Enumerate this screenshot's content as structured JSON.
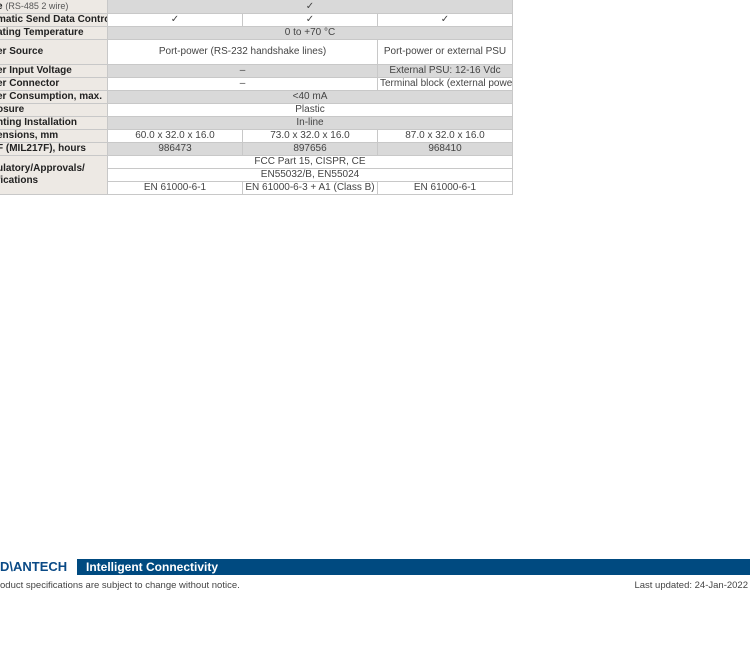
{
  "rows": [
    {
      "label": "e",
      "sub": "(RS-485 2 wire)",
      "span": "✓"
    },
    {
      "label": "matic Send Data Control",
      "cols": [
        "✓",
        "✓",
        "✓"
      ]
    },
    {
      "label": "ating Temperature",
      "span": "0 to +70 °C"
    },
    {
      "label": "er Source",
      "c12": "Port-power (RS-232 handshake lines)",
      "c3": "Port-power or external PSU"
    },
    {
      "label": "er Input Voltage",
      "c12": "–",
      "c3": "External PSU: 12-16 Vdc"
    },
    {
      "label": "er Connector",
      "c12": "–",
      "c3": "Terminal block (external power)"
    },
    {
      "label": "er Consumption, max.",
      "span": "<40 mA"
    },
    {
      "label": "osure",
      "span": "Plastic"
    },
    {
      "label": "nting Installation",
      "span": "In-line"
    },
    {
      "label": "ensions, mm",
      "cols": [
        "60.0 x 32.0 x 16.0",
        "73.0 x 32.0 x 16.0",
        "87.0 x 32.0 x 16.0"
      ]
    },
    {
      "label": "F (MIL217F), hours",
      "cols": [
        "986473",
        "897656",
        "968410"
      ]
    }
  ],
  "regulatory": {
    "label_1": "ulatory/Approvals/",
    "label_2": "fications",
    "line1": "FCC Part 15, CISPR, CE",
    "line2": "EN55032/B, EN55024",
    "cols": [
      "EN 61000-6-1",
      "EN 61000-6-3 + A1 (Class B)",
      "EN 61000-6-1"
    ]
  },
  "footer": {
    "logo": "D\\ANTECH",
    "tagline": "Intelligent Connectivity",
    "notice": "oduct specifications are subject to change without notice.",
    "updated": "Last updated: 24-Jan-2022",
    "brand_color": "#004a80"
  }
}
